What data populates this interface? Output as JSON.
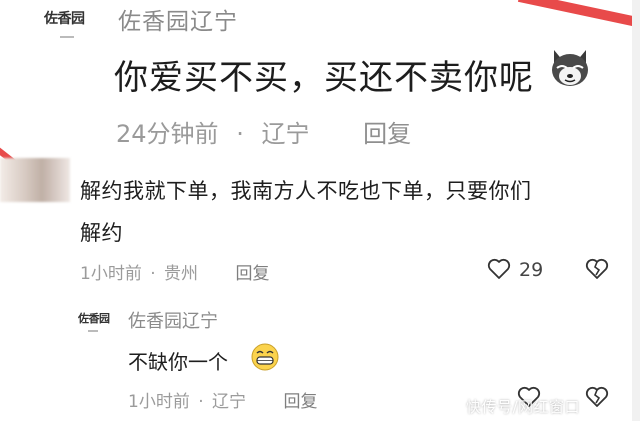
{
  "colors": {
    "accent_stripe": "#e84a4a",
    "meta_text": "#9b9b9b",
    "body_text": "#1e1e1e"
  },
  "reply_top": {
    "author": "佐香园辽宁",
    "avatar_logo": "佐香园",
    "text": "你爱买不买，买还不卖你呢",
    "emoji": "wolf-sticker-icon",
    "time": "24分钟前",
    "location": "辽宁",
    "separator": "·",
    "reply_label": "回复"
  },
  "comment": {
    "text_line1": "解约我就下单，我南方人不吃也下单，只要你们",
    "text_line2": "解约",
    "time": "1小时前",
    "location": "贵州",
    "separator": "·",
    "reply_label": "回复",
    "like_count": "29"
  },
  "sub_reply": {
    "author": "佐香园辽宁",
    "avatar_logo": "佐香园",
    "text": "不缺你一个",
    "emoji": "grin-emoji-icon",
    "time": "1小时前",
    "location": "辽宁",
    "separator": "·",
    "reply_label": "回复"
  },
  "watermark": "快传号/网红窗口"
}
